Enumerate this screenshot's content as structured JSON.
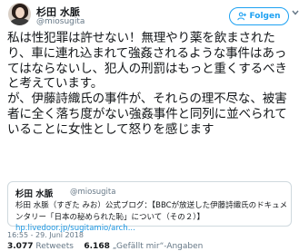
{
  "user": {
    "name": "杉田 水脈",
    "handle": "@miosugita"
  },
  "follow_button": {
    "label": "Folgen",
    "color": "#1da1f2"
  },
  "tweet": {
    "text": "私は性犯罪は許せない！無理やり薬を飲まされたり、車に連れ込まれて強姦されるような事件はあってはならないし、犯人の刑罰はもっと重くするべきと考えています。\nが、伊藤詩織氏の事件が、それらの理不尽な、被害者に全く落ち度がない強姦事件と同列に並べられていることに女性として怒りを感じます"
  },
  "quoted": {
    "name": "杉田 水脈",
    "handle": "@miosugita",
    "text_lead": "杉田 水脈（すぎた みお）公式ブログ：【BBCが放送した伊藤詩織氏のドキュメンタリー「日本の秘められた恥」について（その２）】",
    "link": "hp.livedoor.jp/sugitamio/arch..."
  },
  "timestamp": "16:55 - 29. Juni 2018",
  "stats": {
    "retweets_count": "3.077",
    "retweets_label": "Retweets",
    "likes_count": "6.168",
    "likes_label": "„Gefällt mir“-Angaben"
  }
}
